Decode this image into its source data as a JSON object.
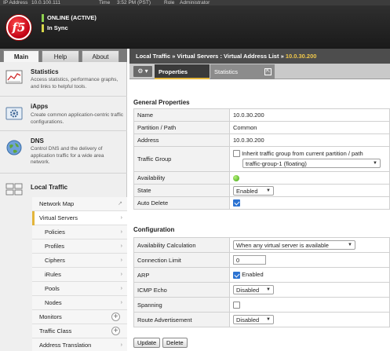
{
  "topstrip": {
    "ip_label": "IP Address",
    "ip": "10.0.100.111",
    "time_label": "Time",
    "time": "3:52 PM (PST)",
    "role_label": "Role",
    "role": "Administrator"
  },
  "header": {
    "logo_text": "f5",
    "status_online": "ONLINE (ACTIVE)",
    "status_sync": "In Sync",
    "colors": {
      "online": "#8fd14f",
      "sync": "#d6d64a"
    }
  },
  "nav": {
    "tabs": [
      "Main",
      "Help",
      "About"
    ],
    "sections": [
      {
        "title": "Statistics",
        "desc": "Access statistics, performance graphs, and links to helpful tools.",
        "icon": "statistics-icon"
      },
      {
        "title": "iApps",
        "desc": "Create common application-centric traffic configurations.",
        "icon": "iapps-icon"
      },
      {
        "title": "DNS",
        "desc": "Control DNS and the delivery of application traffic for a wide area network.",
        "icon": "dns-icon"
      },
      {
        "title": "Local Traffic",
        "icon": "local-traffic-icon"
      }
    ],
    "local_traffic_items": [
      {
        "label": "Network Map"
      },
      {
        "label": "Virtual Servers"
      },
      {
        "label": "Policies"
      },
      {
        "label": "Profiles"
      },
      {
        "label": "Ciphers"
      },
      {
        "label": "iRules"
      },
      {
        "label": "Pools"
      },
      {
        "label": "Nodes"
      },
      {
        "label": "Monitors"
      },
      {
        "label": "Traffic Class"
      },
      {
        "label": "Address Translation"
      }
    ]
  },
  "content": {
    "breadcrumb": {
      "root": "Local Traffic",
      "sep": "»",
      "section": "Virtual Servers : Virtual Address List",
      "current": "10.0.30.200"
    },
    "tabs": [
      {
        "label": "Properties"
      },
      {
        "label": "Statistics"
      }
    ],
    "general": {
      "heading": "General Properties",
      "name_label": "Name",
      "name": "10.0.30.200",
      "partition_label": "Partition / Path",
      "partition": "Common",
      "address_label": "Address",
      "address": "10.0.30.200",
      "traffic_group_label": "Traffic Group",
      "inherit_label": "Inherit traffic group from current partition / path",
      "inherit_checked": false,
      "traffic_group": "traffic-group-1 (floating)",
      "availability_label": "Availability",
      "availability_status": "available",
      "state_label": "State",
      "state": "Enabled",
      "auto_delete_label": "Auto Delete",
      "auto_delete": true
    },
    "configuration": {
      "heading": "Configuration",
      "avail_calc_label": "Availability Calculation",
      "avail_calc": "When any virtual server is available",
      "conn_limit_label": "Connection Limit",
      "conn_limit": "0",
      "arp_label": "ARP",
      "arp_value": "Enabled",
      "arp": true,
      "icmp_label": "ICMP Echo",
      "icmp": "Disabled",
      "spanning_label": "Spanning",
      "spanning": false,
      "route_label": "Route Advertisement",
      "route": "Disabled"
    },
    "buttons": {
      "update": "Update",
      "delete": "Delete"
    }
  }
}
